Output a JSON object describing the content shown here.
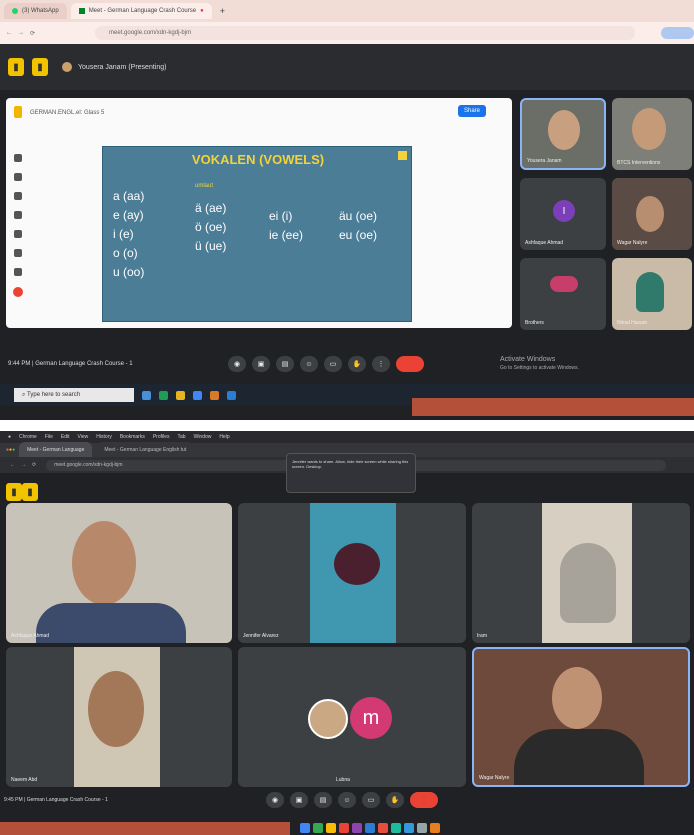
{
  "top": {
    "tabs": [
      "(3) WhatsApp",
      "Meet - German Language Crash Course"
    ],
    "url": "meet.google.com/xdn-kgdj-bjm",
    "presenting_label": "Yousera Janam (Presenting)",
    "doc_title": "GERMAN.ENGL.el: Glass 5",
    "share_button": "Share",
    "slide": {
      "title": "VOKALEN (VOWELS)",
      "col1": [
        "a (aa)",
        "e (ay)",
        "i (e)",
        "o (o)",
        "u (oo)"
      ],
      "umlaut_label": "umlaut",
      "col2": [
        "ä (ae)",
        "ö (oe)",
        "ü (ue)"
      ],
      "col3": [
        "ei (i)",
        "ie (ee)"
      ],
      "col4": [
        "äu (oe)",
        "eu (oe)"
      ]
    },
    "participants": [
      {
        "name": "Yousera Janam",
        "avatar": ""
      },
      {
        "name": "BTCS Interventions",
        "avatar": ""
      },
      {
        "name": "Ashfaque Ahmad",
        "avatar": "I"
      },
      {
        "name": "Wagar Nalyre",
        "avatar": ""
      },
      {
        "name": "Brothers",
        "avatar": ""
      },
      {
        "name": "Nimal Hazam",
        "avatar": ""
      }
    ],
    "meeting_info": "9:44 PM  |  German Language Crash Course - 1",
    "activate_windows": "Activate Windows",
    "activate_sub": "Go to Settings to activate Windows.",
    "search_placeholder": "Type here to search",
    "colors": {
      "slide_bg": "#4b7d97",
      "title": "#f4d23a",
      "end_call": "#ea4335",
      "accent_bar": "#b4503a"
    }
  },
  "bottom": {
    "menu": [
      "Chrome",
      "File",
      "Edit",
      "View",
      "History",
      "Bookmarks",
      "Profiles",
      "Tab",
      "Window",
      "Help"
    ],
    "tabs": [
      "Meet - German Language",
      "Meet - German Language English tut"
    ],
    "url": "meet.google.com/xdn-kgdj-bjm",
    "notification": "Jennifer wants to share. Allow, hide their screen while sharing this screen. Desktop.",
    "participants": [
      {
        "name": "Ashfaque Ahmad",
        "avatar": ""
      },
      {
        "name": "Jennifer Alvarez",
        "avatar": ""
      },
      {
        "name": "Iram",
        "avatar": ""
      },
      {
        "name": "Naeem Abd",
        "avatar": ""
      },
      {
        "name": "Lubna",
        "avatar": "m"
      },
      {
        "name": "Wagar Nalyre",
        "avatar": ""
      }
    ],
    "meeting_info": "9:45 PM  |  German Language Crash Course - 1"
  }
}
